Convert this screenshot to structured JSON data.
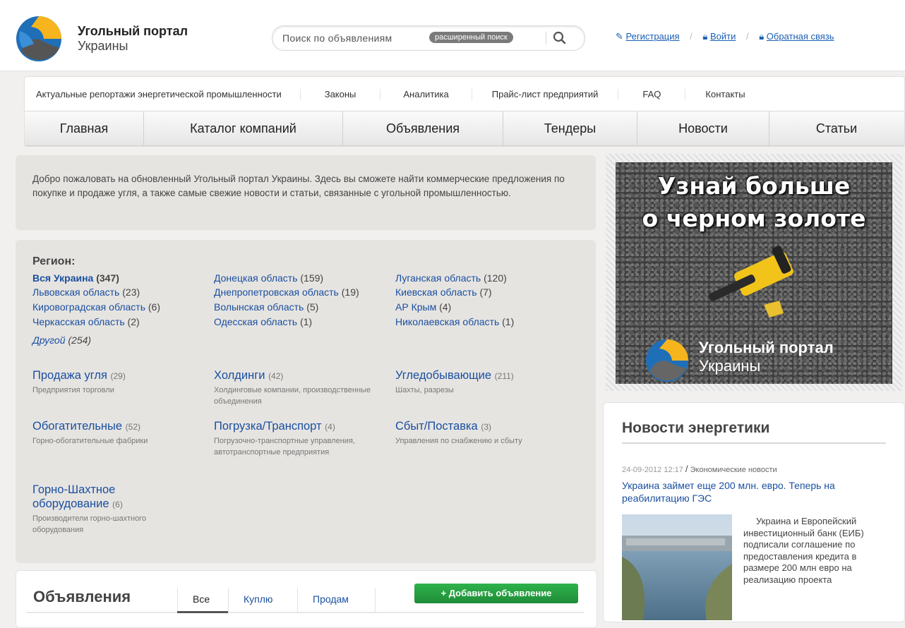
{
  "header": {
    "logo_title": "Угольный портал",
    "logo_subtitle": "Украины",
    "search_placeholder": "Поиск по объявлениям",
    "advanced_search": "расширенный поиск",
    "links": [
      {
        "icon": "edit-icon",
        "label": "Регистрация"
      },
      {
        "icon": "lock-icon",
        "label": "Войти"
      },
      {
        "icon": "lock-icon",
        "label": "Обратная связь"
      }
    ]
  },
  "subnav": [
    "Актуальные репортажи энергетической промышленности",
    "Законы",
    "Аналитика",
    "Прайс-лист предприятий",
    "FAQ",
    "Контакты"
  ],
  "mainnav": [
    "Главная",
    "Каталог компаний",
    "Объявления",
    "Тендеры",
    "Новости",
    "Статьи"
  ],
  "welcome": "Добро пожаловать на обновленный Угольный портал Украины. Здесь вы сможете найти коммерческие предложения по покупке и продаже угля, а также самые свежие новости и статьи, связанные с угольной промышленностью.",
  "regions": {
    "title": "Регион:",
    "items": [
      {
        "name": "Вся Украина",
        "count": "(347)"
      },
      {
        "name": "Донецкая область",
        "count": "(159)"
      },
      {
        "name": "Луганская область",
        "count": "(120)"
      },
      {
        "name": "Львовская область",
        "count": "(23)"
      },
      {
        "name": "Днепропетровская область",
        "count": "(19)"
      },
      {
        "name": "Киевская область",
        "count": "(7)"
      },
      {
        "name": "Кировоградская область",
        "count": "(6)"
      },
      {
        "name": "Волынская область",
        "count": "(5)"
      },
      {
        "name": "АР Крым",
        "count": "(4)"
      },
      {
        "name": "Черкасская область",
        "count": "(2)"
      },
      {
        "name": "Одесская область",
        "count": "(1)"
      },
      {
        "name": "Николаевская область",
        "count": "(1)"
      },
      {
        "name": "Другой",
        "count": "(254)"
      }
    ]
  },
  "categories": [
    {
      "title": "Продажа угля",
      "count": "(29)",
      "desc": "Предприятия торговли"
    },
    {
      "title": "Холдинги",
      "count": "(42)",
      "desc": "Холдинговые компании, производственные объединения"
    },
    {
      "title": "Угледобывающие",
      "count": "(211)",
      "desc": "Шахты, разрезы"
    },
    {
      "title": "Обогатительные",
      "count": "(52)",
      "desc": "Горно-обогатительные фабрики"
    },
    {
      "title": "Погрузка/Транспорт",
      "count": "(4)",
      "desc": "Погрузочно-транспортные управления, автотранспортные предприятия"
    },
    {
      "title": "Сбыт/Поставка",
      "count": "(3)",
      "desc": "Управления по снабжению и сбыту"
    },
    {
      "title_line1": "Горно-Шахтное",
      "title_line2": "оборудование",
      "count": "(6)",
      "desc": "Производители горно-шахтного оборудования"
    }
  ],
  "ads": {
    "title": "Объявления",
    "tabs": [
      "Все",
      "Куплю",
      "Продам"
    ],
    "add_button": "+ Добавить объявление"
  },
  "banner": {
    "line1": "Узнай больше",
    "line2": "о черном золоте",
    "logo_title": "Угольный портал",
    "logo_subtitle": "Украины"
  },
  "news": {
    "title": "Новости энергетики",
    "date": "24-09-2012 12:17",
    "separator": "/",
    "category": "Экономические новости",
    "headline": "Украина займет еще 200 млн. евро. Теперь на реабилитацию ГЭС",
    "text": "Украина и Европейский инвестиционный банк (ЕИБ) подписали соглашение по предоставления кредита в размере 200 млн евро на реализацию проекта"
  },
  "colors": {
    "link": "#1a4fa0",
    "panel_bg": "#e6e4e1",
    "add_button": "#1f8c37"
  }
}
